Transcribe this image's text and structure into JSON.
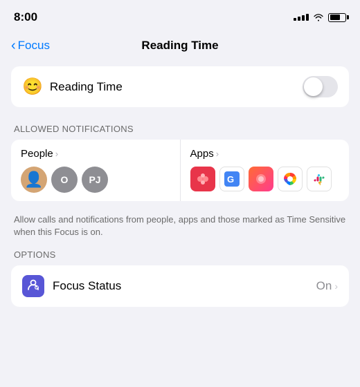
{
  "statusBar": {
    "time": "8:00"
  },
  "navigation": {
    "backLabel": "Focus",
    "title": "Reading Time"
  },
  "readingTimeToggle": {
    "emoji": "😊",
    "label": "Reading Time",
    "isOn": false
  },
  "sections": {
    "allowedNotifications": {
      "sectionLabel": "ALLOWED NOTIFICATIONS",
      "peopleTitle": "People",
      "appsTitle": "Apps",
      "description": "Allow calls and notifications from people, apps and those marked as Time Sensitive when this Focus is on.",
      "people": [
        {
          "initials": "",
          "type": "photo"
        },
        {
          "initials": "O",
          "type": "initial"
        },
        {
          "initials": "PJ",
          "type": "initial"
        }
      ]
    },
    "options": {
      "sectionLabel": "OPTIONS",
      "items": [
        {
          "label": "Focus Status",
          "value": "On"
        }
      ]
    }
  }
}
